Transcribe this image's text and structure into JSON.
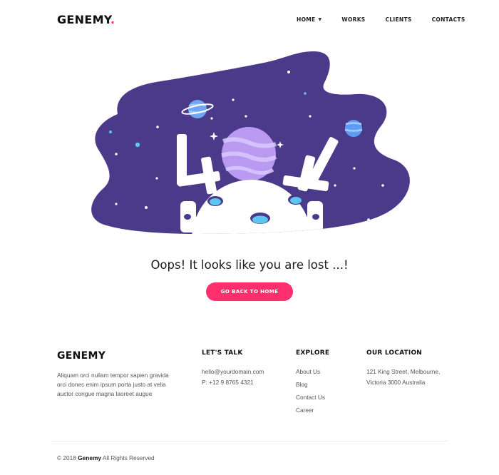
{
  "header": {
    "logo_text": "GENEMY",
    "logo_dot": ".",
    "nav": [
      {
        "label": "HOME",
        "has_dropdown": true
      },
      {
        "label": "WORKS"
      },
      {
        "label": "CLIENTS"
      },
      {
        "label": "CONTACTS"
      }
    ]
  },
  "hero": {
    "error_code": "404",
    "message": "Oops! It looks like you are lost ...!",
    "button_label": "GO BACK TO HOME"
  },
  "footer": {
    "brand": "GENEMY",
    "about": "Aliquam orci nullam tempor sapien gravida orci donec enim ipsum porta justo at velia auctor congue magna laoreet augue",
    "talk": {
      "heading": "LET'S TALK",
      "email": "hello@yourdomain.com",
      "phone": "P: +12 9 8765 4321"
    },
    "explore": {
      "heading": "EXPLORE",
      "links": [
        "About Us",
        "Blog",
        "Contact Us",
        "Career"
      ]
    },
    "location": {
      "heading": "OUR LOCATION",
      "line1": "121 King Street, Melbourne,",
      "line2": "Victoria 3000 Australia"
    }
  },
  "copyright": {
    "prefix": "© 2018",
    "brand": "Genemy",
    "suffix": "All Rights Reserved"
  },
  "colors": {
    "accent": "#ff2f6e",
    "space": "#4b3a8a",
    "planet": "#b99af0",
    "sky_blue": "#5cc6f0"
  }
}
